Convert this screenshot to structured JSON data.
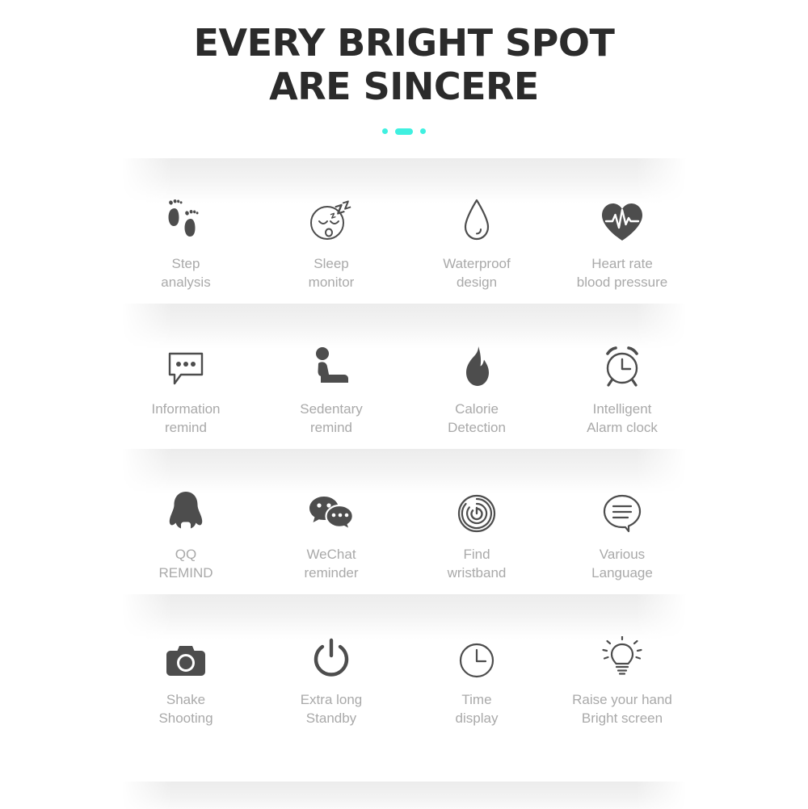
{
  "header": {
    "title_line1": "EVERY BRIGHT SPOT",
    "title_line2": "ARE SINCERE",
    "accent_color": "#3ff0e0",
    "title_color": "#2b2b2b"
  },
  "styles": {
    "label_color": "#a9a9a9",
    "icon_color": "#4d4d4d",
    "band_color": "#ececec",
    "background": "#ffffff"
  },
  "features": {
    "rows": [
      {
        "cells": [
          {
            "icon": "footprints-icon",
            "label": "Step\nanalysis"
          },
          {
            "icon": "sleeping-face-icon",
            "label": "Sleep\nmonitor"
          },
          {
            "icon": "water-drop-icon",
            "label": "Waterproof\ndesign"
          },
          {
            "icon": "heart-pulse-icon",
            "label": "Heart rate\nblood pressure"
          }
        ]
      },
      {
        "cells": [
          {
            "icon": "message-bubble-icon",
            "label": "Information\nremind"
          },
          {
            "icon": "seated-person-icon",
            "label": "Sedentary\nremind"
          },
          {
            "icon": "flame-icon",
            "label": "Calorie\nDetection"
          },
          {
            "icon": "alarm-clock-icon",
            "label": "Intelligent\nAlarm clock"
          }
        ]
      },
      {
        "cells": [
          {
            "icon": "qq-penguin-icon",
            "label": "QQ\nREMIND"
          },
          {
            "icon": "wechat-bubbles-icon",
            "label": "WeChat\nreminder"
          },
          {
            "icon": "signal-rings-icon",
            "label": "Find\nwristband"
          },
          {
            "icon": "chat-lines-icon",
            "label": "Various\nLanguage"
          }
        ]
      },
      {
        "cells": [
          {
            "icon": "camera-icon",
            "label": "Shake\nShooting"
          },
          {
            "icon": "power-icon",
            "label": "Extra long\nStandby"
          },
          {
            "icon": "clock-icon",
            "label": "Time\ndisplay"
          },
          {
            "icon": "light-bulb-icon",
            "label": "Raise your hand\nBright screen"
          }
        ]
      }
    ]
  }
}
